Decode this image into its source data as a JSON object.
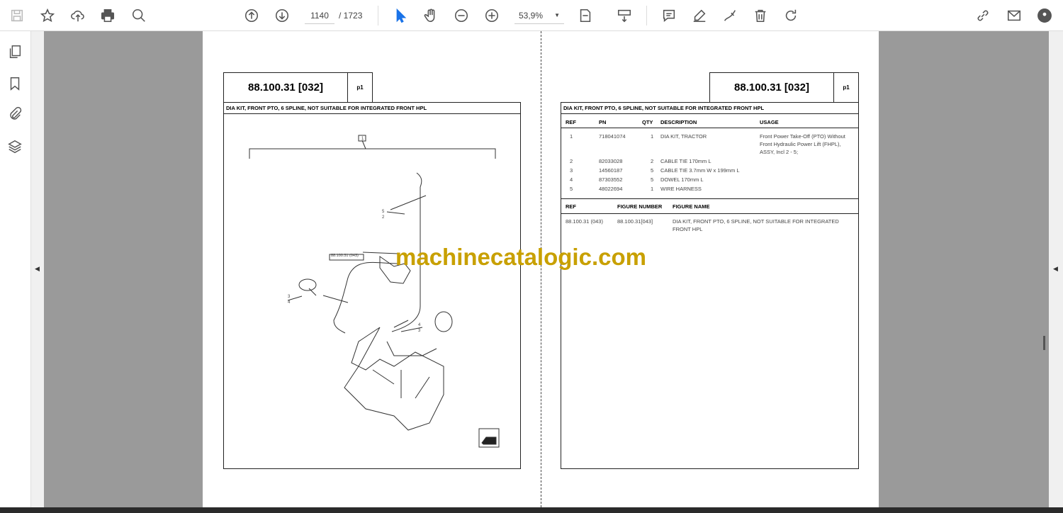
{
  "toolbar": {
    "page_current": "1140",
    "page_total": "/ 1723",
    "zoom": "53,9%"
  },
  "left_page": {
    "code": "88.100.31 [032]",
    "page_label": "p1",
    "heading": "DIA KIT, FRONT PTO, 6 SPLINE, NOT SUITABLE FOR INTEGRATED FRONT HPL",
    "callouts": {
      "c1": "1",
      "c5": "5",
      "c2": "2",
      "ref": "88.100.31 (043)",
      "c3a": "3",
      "c4a": "4",
      "c4b": "4",
      "c3b": "3"
    }
  },
  "right_page": {
    "code": "88.100.31 [032]",
    "page_label": "p1",
    "heading": "DIA KIT, FRONT PTO, 6 SPLINE, NOT SUITABLE FOR INTEGRATED FRONT HPL",
    "parts_headers": {
      "ref": "REF",
      "pn": "PN",
      "qty": "QTY",
      "description": "DESCRIPTION",
      "usage": "USAGE"
    },
    "parts": [
      {
        "ref": "1",
        "pn": "718041074",
        "qty": "1",
        "description": "DIA KIT, TRACTOR",
        "usage": "Front Power Take-Off (PTO) Without Front Hydraulic Power Lift (FHPL), ASSY, Incl 2 - 5;"
      },
      {
        "ref": "2",
        "pn": "82033028",
        "qty": "2",
        "description": "CABLE TIE 170mm L",
        "usage": ""
      },
      {
        "ref": "3",
        "pn": "14560187",
        "qty": "5",
        "description": "CABLE TIE 3.7mm W x 199mm L",
        "usage": ""
      },
      {
        "ref": "4",
        "pn": "87303552",
        "qty": "5",
        "description": "DOWEL 170mm L",
        "usage": ""
      },
      {
        "ref": "5",
        "pn": "48022694",
        "qty": "1",
        "description": "WIRE HARNESS",
        "usage": ""
      }
    ],
    "fig_headers": {
      "ref": "REF",
      "number": "FIGURE NUMBER",
      "name": "FIGURE NAME"
    },
    "figures": [
      {
        "ref": "88.100.31 (043)",
        "number": "88.100.31[043]",
        "name": "DIA KIT, FRONT PTO, 6 SPLINE, NOT SUITABLE FOR INTEGRATED FRONT HPL"
      }
    ]
  },
  "watermark": "machinecatalogic.com"
}
